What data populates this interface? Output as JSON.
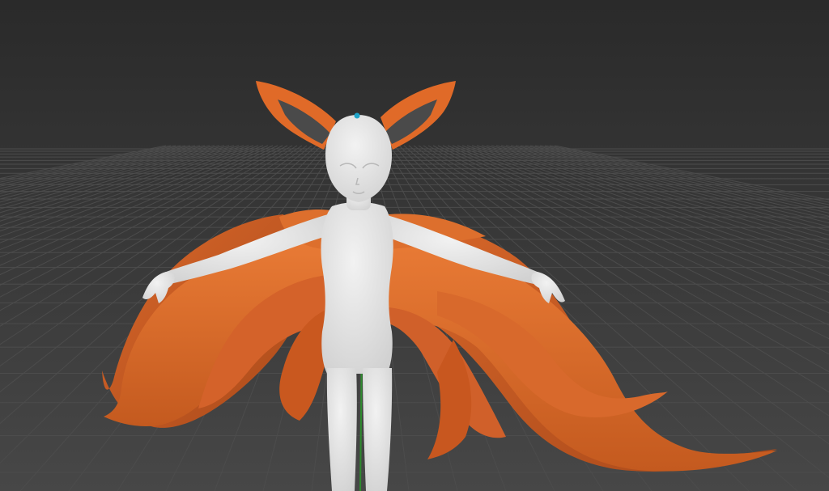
{
  "viewport": {
    "background_top": "#2b2b2b",
    "background_bottom": "#464646",
    "grid_line_color": "#4c4c4c",
    "y_axis_color": "#2f8f2f",
    "origin_marker_color": "#1fa3c8"
  },
  "model": {
    "body_color": "#e6e6e6",
    "fur_color": "#e06a28",
    "fur_dark_color": "#b9501c",
    "ear_inner_color": "#4a4a4a",
    "tail_count": 9
  }
}
